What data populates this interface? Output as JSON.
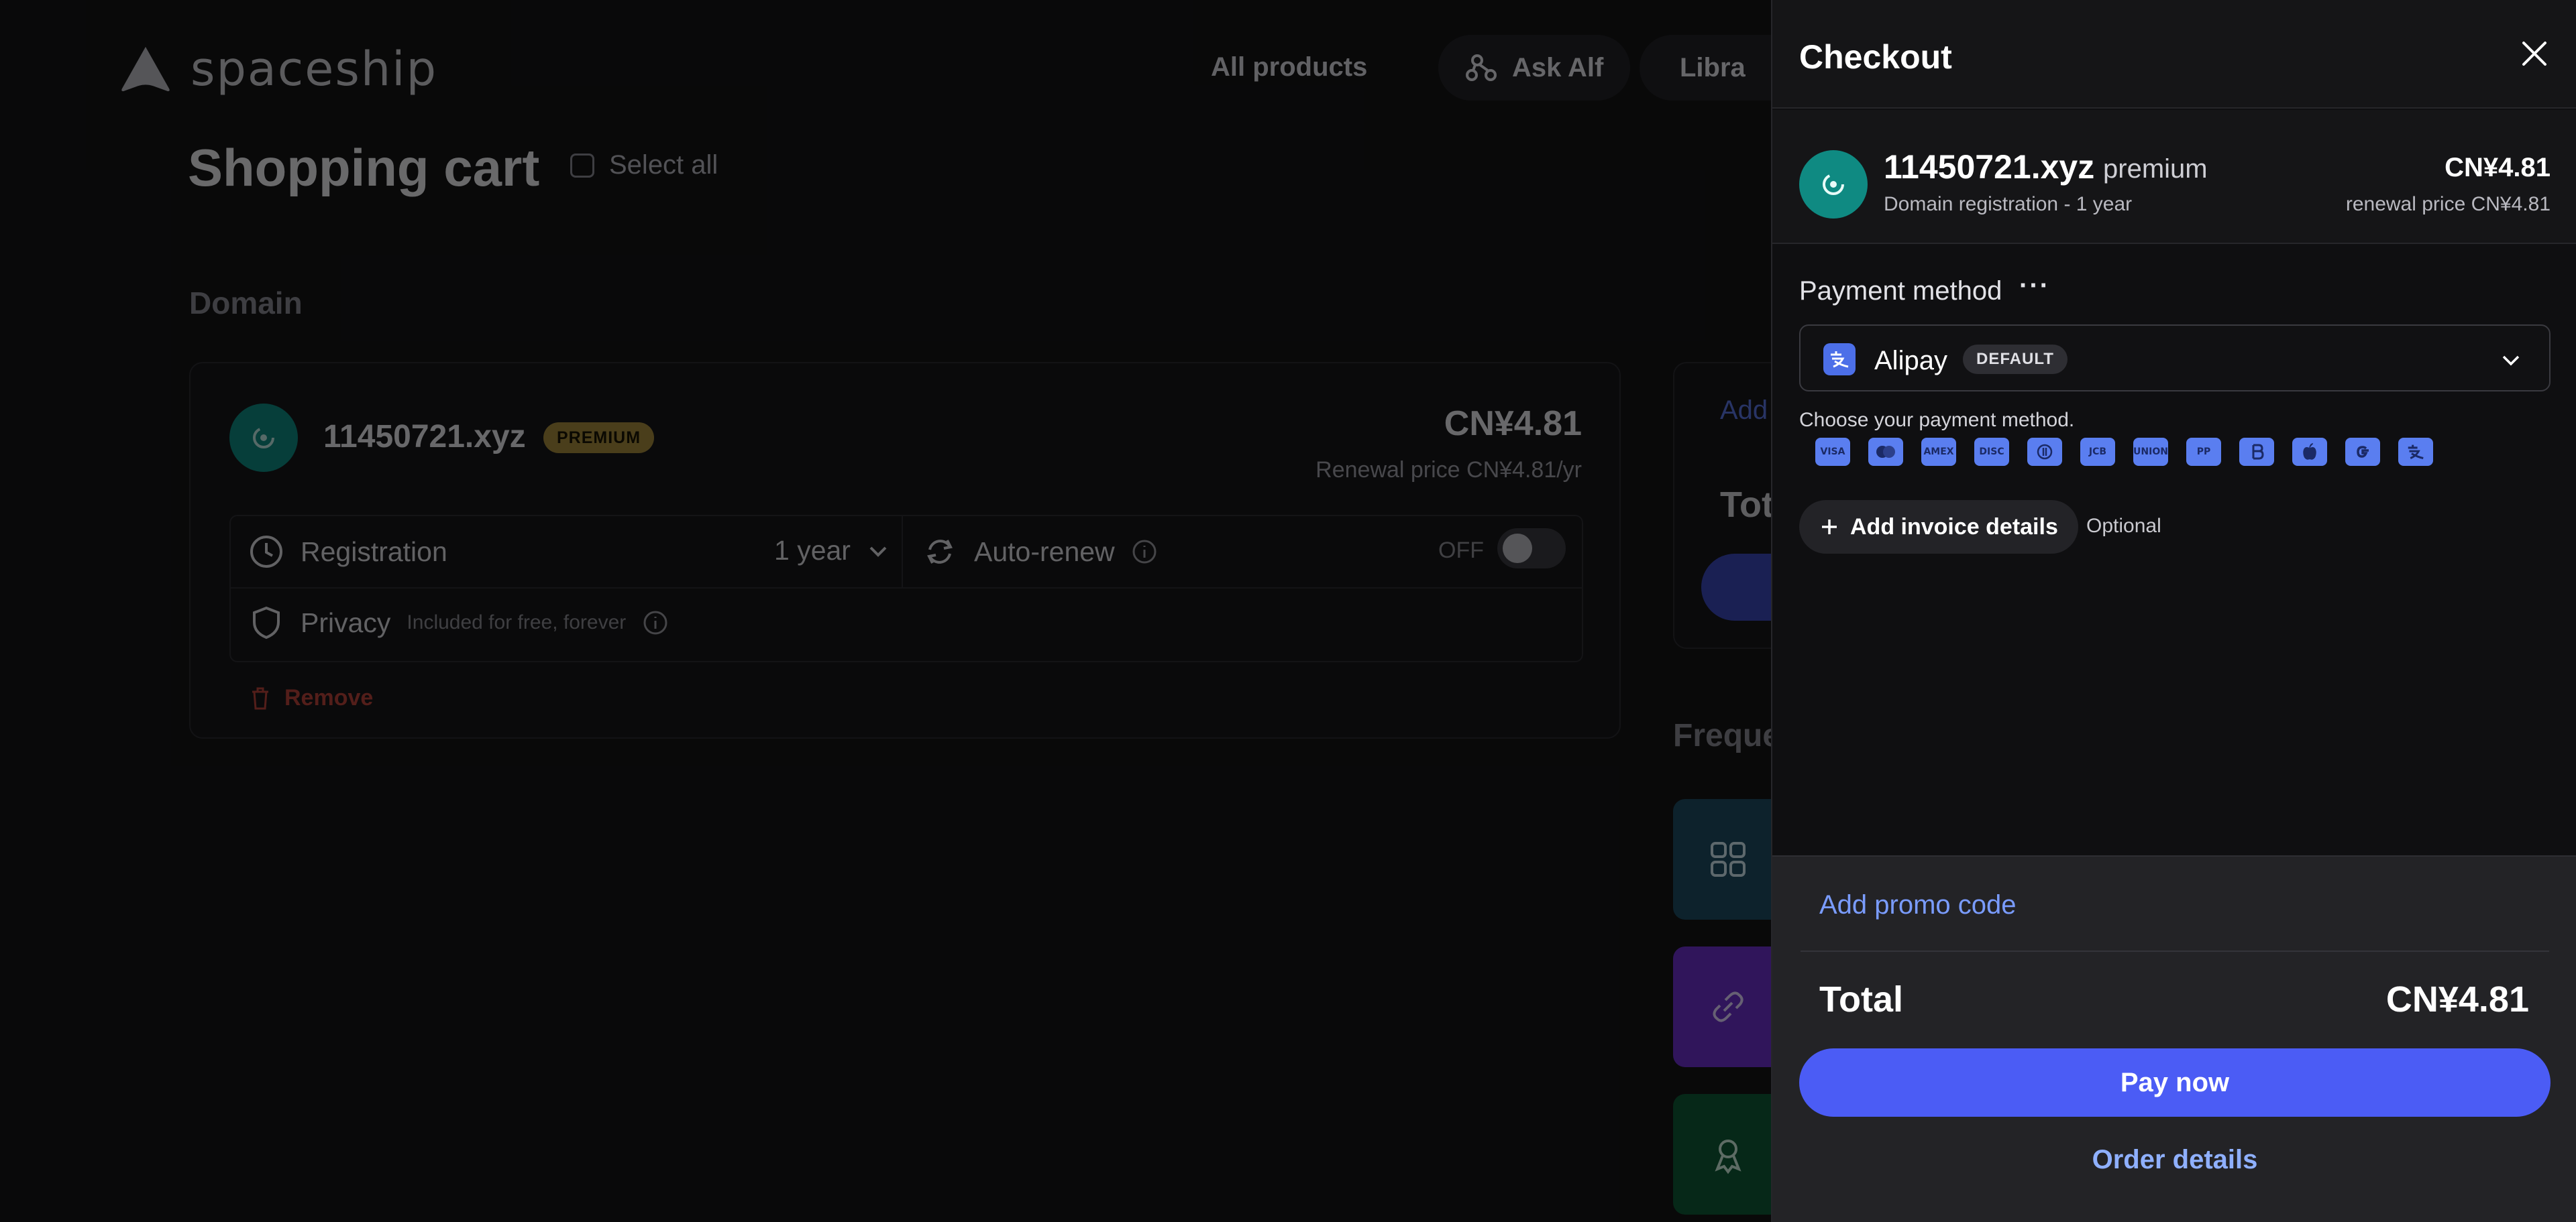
{
  "brand": {
    "name": "spaceship"
  },
  "nav": {
    "all_products": "All products",
    "ask_alf": "Ask Alf",
    "library": "Libra"
  },
  "cart": {
    "title": "Shopping cart",
    "select_all": "Select all",
    "section": "Domain",
    "item": {
      "name": "11450721.xyz",
      "badge": "PREMIUM",
      "price": "CN¥4.81",
      "renewal": "Renewal price CN¥4.81/yr",
      "registration_label": "Registration",
      "registration_value": "1 year",
      "auto_renew_label": "Auto-renew",
      "auto_renew_state": "OFF",
      "privacy_label": "Privacy",
      "privacy_note": "Included for free, forever",
      "remove": "Remove"
    }
  },
  "summary": {
    "add": "Add",
    "total": "Tota"
  },
  "frequently": {
    "title": "Freque"
  },
  "checkout": {
    "title": "Checkout",
    "item": {
      "name": "11450721.xyz",
      "tier": "premium",
      "desc": "Domain registration - 1 year",
      "price": "CN¥4.81",
      "renewal": "renewal price CN¥4.81"
    },
    "payment": {
      "label": "Payment method",
      "more": "···",
      "selected": "Alipay",
      "default_badge": "DEFAULT",
      "hint": "Choose your payment method.",
      "icons": [
        "VISA",
        "MC",
        "AMEX",
        "DISC",
        "DC",
        "JCB",
        "UNION",
        "PP",
        "BTC",
        "APPLE",
        "G",
        "ALI"
      ]
    },
    "invoice": {
      "button": "Add invoice details",
      "optional": "Optional"
    },
    "footer": {
      "promo": "Add promo code",
      "total_label": "Total",
      "total_value": "CN¥4.81",
      "pay": "Pay now",
      "order_details": "Order details"
    }
  },
  "colors": {
    "accent": "#4b5cf5",
    "link": "#7a9cff",
    "domain_avatar": "#0f8a82",
    "premium_badge": "#a58b3c",
    "remove": "#b8433a"
  }
}
